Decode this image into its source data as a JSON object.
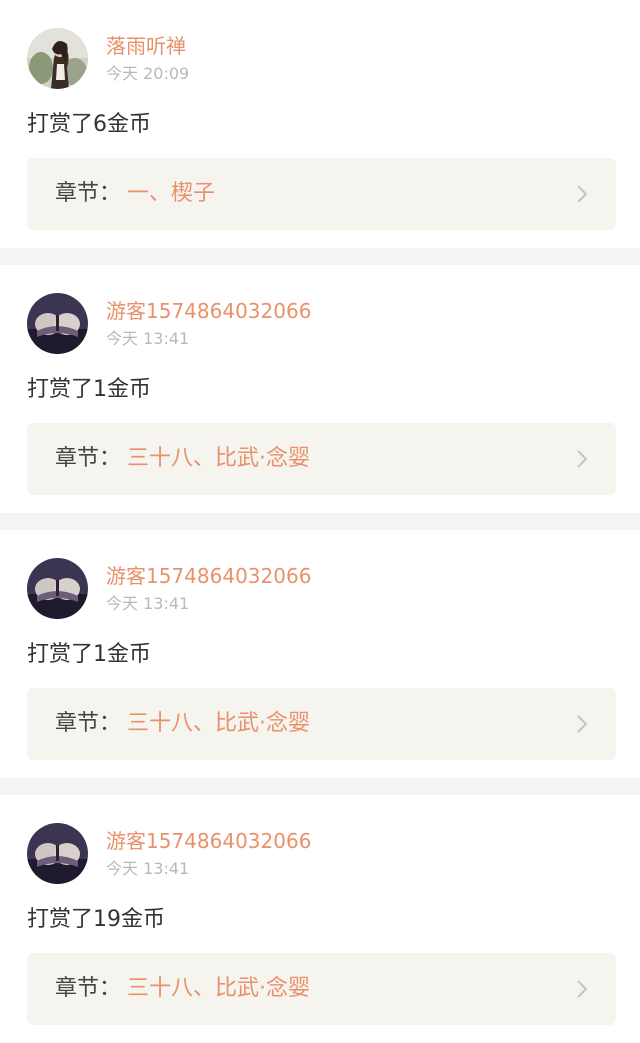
{
  "records": [
    {
      "user": "落雨听禅",
      "time": "今天 20:09",
      "action": "打赏了6金币",
      "chapter_prefix": "章节：",
      "chapter_title": "一、楔子",
      "avatar": "photo-avatar"
    },
    {
      "user": "游客1574864032066",
      "time": "今天 13:41",
      "action": "打赏了1金币",
      "chapter_prefix": "章节：",
      "chapter_title": "三十八、比武·念婴",
      "avatar": "guest-avatar"
    },
    {
      "user": "游客1574864032066",
      "time": "今天 13:41",
      "action": "打赏了1金币",
      "chapter_prefix": "章节：",
      "chapter_title": "三十八、比武·念婴",
      "avatar": "guest-avatar"
    },
    {
      "user": "游客1574864032066",
      "time": "今天 13:41",
      "action": "打赏了19金币",
      "chapter_prefix": "章节：",
      "chapter_title": "三十八、比武·念婴",
      "avatar": "guest-avatar"
    }
  ],
  "colors": {
    "accent": "#e8916a",
    "time": "#b9b9b9",
    "chapter_bg": "#f5f4ef",
    "page_bg": "#f5f4f2"
  }
}
